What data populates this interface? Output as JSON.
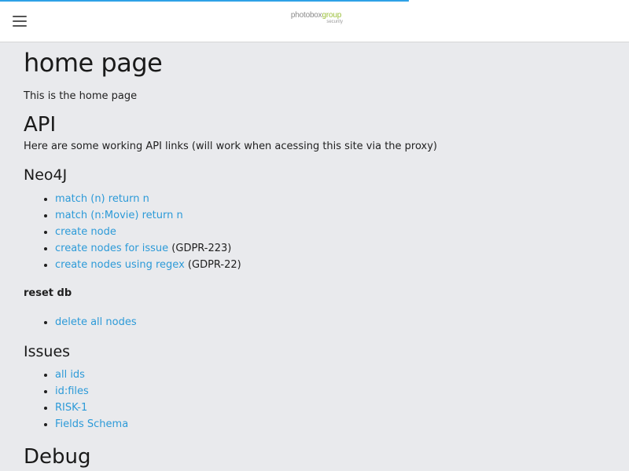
{
  "header": {
    "menu_icon": "hamburger-menu-icon",
    "logo_primary": "photobox",
    "logo_secondary": "group",
    "logo_sub": "security",
    "progress_percent": 65,
    "accent_color": "#2ea1e6"
  },
  "page": {
    "title": "home page",
    "intro": "This is the home page"
  },
  "api": {
    "heading": "API",
    "description": "Here are some working API links (will work when acessing this site via the proxy)"
  },
  "neo4j": {
    "heading": "Neo4J",
    "links": [
      {
        "label": "match (n) return n",
        "note": ""
      },
      {
        "label": "match (n:Movie) return n",
        "note": ""
      },
      {
        "label": "create node",
        "note": ""
      },
      {
        "label": "create nodes for issue",
        "note": "(GDPR-223)"
      },
      {
        "label": "create nodes using regex",
        "note": "(GDPR-22)"
      }
    ]
  },
  "reset": {
    "heading": "reset db",
    "links": [
      {
        "label": "delete all nodes"
      }
    ]
  },
  "issues": {
    "heading": "Issues",
    "links": [
      {
        "label": "all ids"
      },
      {
        "label": "id:files"
      },
      {
        "label": "RISK-1"
      },
      {
        "label": "Fields Schema"
      }
    ]
  },
  "debug": {
    "heading": "Debug"
  },
  "colors": {
    "link": "#2c9ad8",
    "background": "#e9eaed"
  }
}
